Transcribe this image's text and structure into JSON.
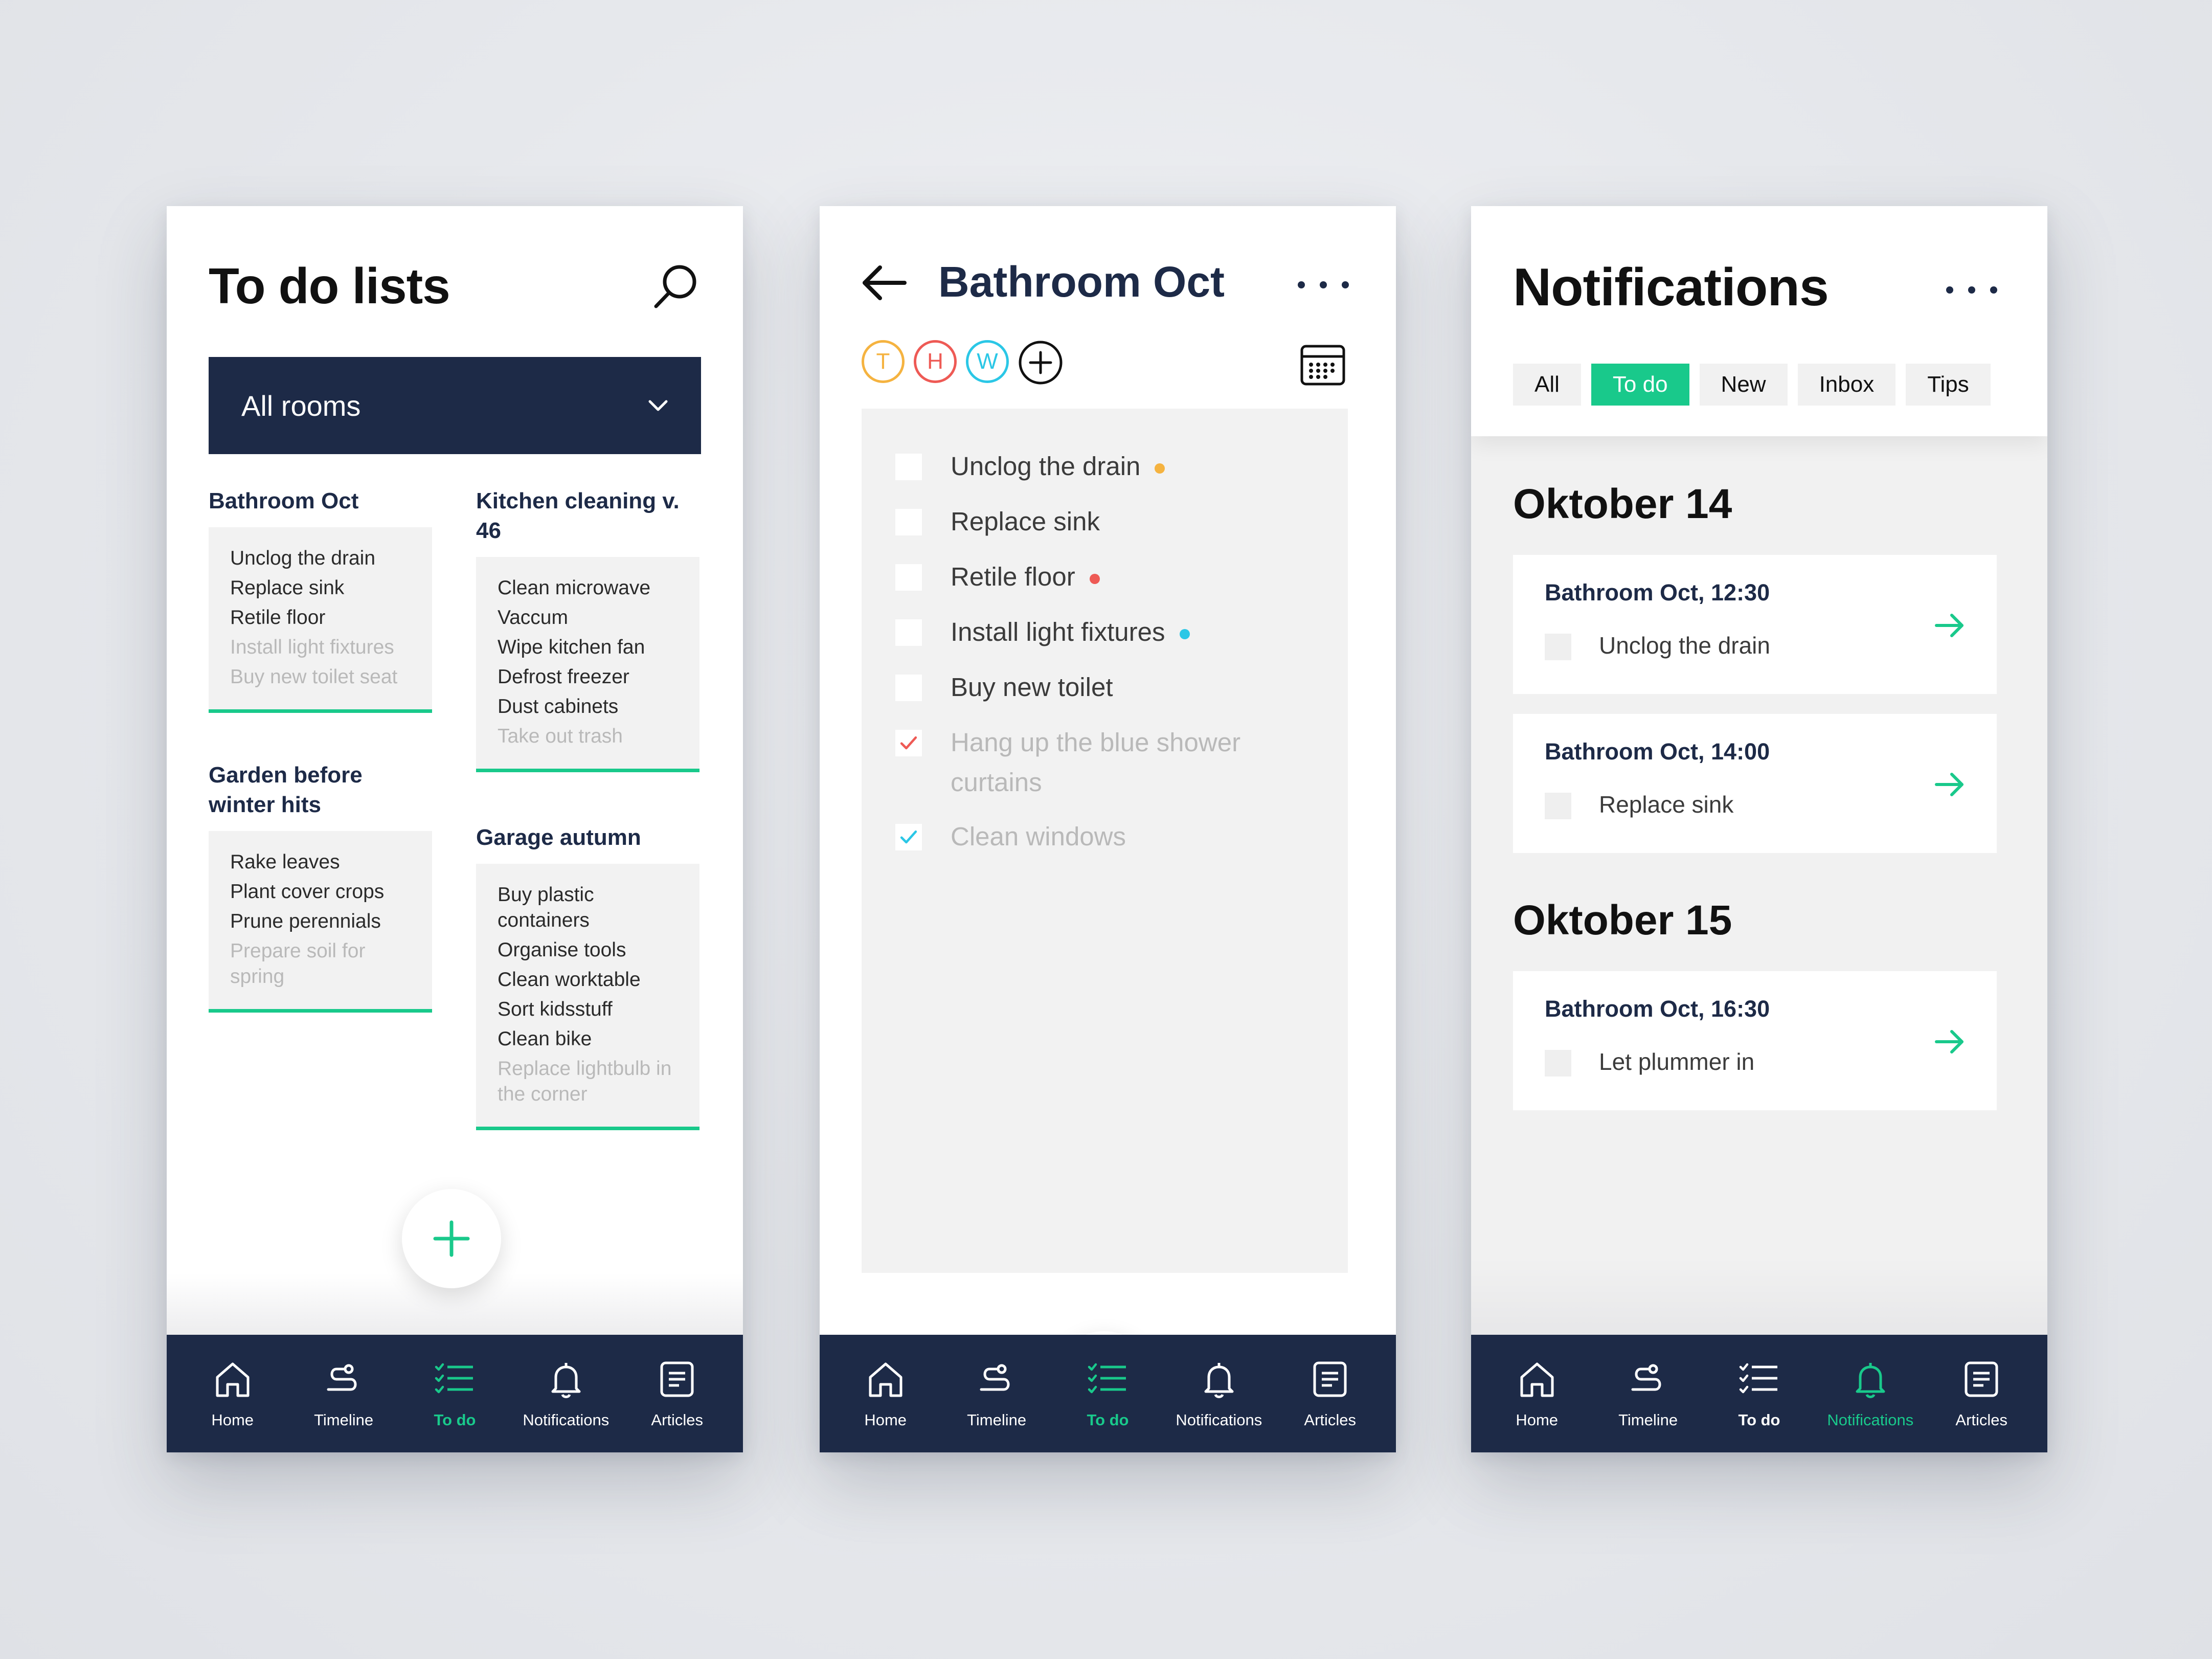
{
  "colors": {
    "accent": "#19c98b",
    "navy": "#1d2a47",
    "orange": "#f5b340",
    "red": "#ee5a55",
    "cyan": "#2bc7e6"
  },
  "nav": {
    "items": [
      {
        "label": "Home",
        "icon": "home-icon"
      },
      {
        "label": "Timeline",
        "icon": "timeline-icon"
      },
      {
        "label": "To do",
        "icon": "todo-list-icon"
      },
      {
        "label": "Notifications",
        "icon": "bell-icon"
      },
      {
        "label": "Articles",
        "icon": "articles-icon"
      }
    ]
  },
  "screen1": {
    "title": "To do lists",
    "dropdown": {
      "selected": "All rooms"
    },
    "lists": [
      {
        "title": "Bathroom Oct",
        "items": [
          "Unclog the drain",
          "Replace sink",
          "Retile floor"
        ],
        "done": [
          "Install light fixtures",
          "Buy new toilet seat"
        ]
      },
      {
        "title": "Garden before winter hits",
        "items": [
          "Rake leaves",
          "Plant cover crops",
          "Prune perennials"
        ],
        "done": [
          "Prepare soil for spring"
        ]
      },
      {
        "title": "Kitchen cleaning v. 46",
        "items": [
          "Clean microwave",
          "Vaccum",
          "Wipe kitchen fan",
          "Defrost freezer",
          "Dust cabinets"
        ],
        "done": [
          "Take out trash"
        ]
      },
      {
        "title": "Garage autumn",
        "items": [
          "Buy plastic containers",
          "Organise tools",
          "Clean worktable",
          "Sort kidsstuff",
          "Clean bike"
        ],
        "done": [
          "Replace lightbulb in the corner"
        ]
      }
    ]
  },
  "screen2": {
    "title": "Bathroom Oct",
    "avatars": [
      {
        "letter": "T",
        "color": "#f5b340"
      },
      {
        "letter": "H",
        "color": "#ee5a55"
      },
      {
        "letter": "W",
        "color": "#2bc7e6"
      }
    ],
    "tasks": [
      {
        "text": "Unclog the drain",
        "dot": "#f5b340"
      },
      {
        "text": "Replace sink"
      },
      {
        "text": "Retile floor",
        "dot": "#ee5a55"
      },
      {
        "text": "Install light fixtures",
        "dot": "#2bc7e6"
      },
      {
        "text": "Buy new toilet"
      },
      {
        "text": "Hang up the blue shower curtains",
        "checked": true,
        "check_color": "#ee5a55"
      },
      {
        "text": "Clean windows",
        "checked": true,
        "check_color": "#2bc7e6"
      }
    ]
  },
  "screen3": {
    "title": "Notifications",
    "filters": [
      {
        "label": "All"
      },
      {
        "label": "To do",
        "active": true
      },
      {
        "label": "New"
      },
      {
        "label": "Inbox"
      },
      {
        "label": "Tips"
      }
    ],
    "days": [
      {
        "label": "Oktober 14",
        "cards": [
          {
            "title": "Bathroom Oct, 12:30",
            "text": "Unclog the drain"
          },
          {
            "title": "Bathroom Oct, 14:00",
            "text": "Replace sink"
          }
        ]
      },
      {
        "label": "Oktober 15",
        "cards": [
          {
            "title": "Bathroom Oct, 16:30",
            "text": "Let plummer in"
          }
        ]
      }
    ]
  }
}
